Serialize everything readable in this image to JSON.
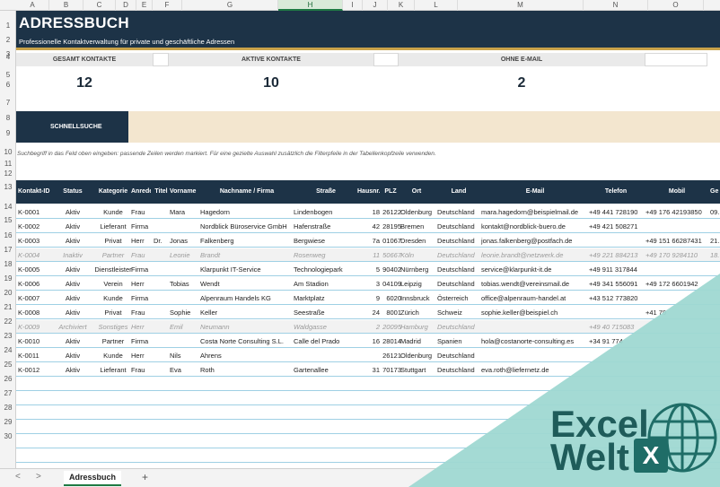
{
  "columns": [
    "A",
    "B",
    "C",
    "D",
    "E",
    "F",
    "G",
    "H",
    "I",
    "J",
    "K",
    "L",
    "M",
    "N",
    "O"
  ],
  "selected_column": "H",
  "rows": [
    "1",
    "2",
    "3",
    "4",
    "5",
    "6",
    "7",
    "8",
    "9",
    "10",
    "11",
    "12",
    "13",
    "14",
    "15",
    "16",
    "17",
    "18",
    "19",
    "20",
    "21",
    "22",
    "23",
    "24",
    "25",
    "26",
    "27",
    "28",
    "29",
    "30"
  ],
  "header": {
    "title": "ADRESSBUCH",
    "subtitle": "Professionelle Kontaktverwaltung für private und geschäftliche Adressen"
  },
  "kpis": [
    {
      "label": "GESAMT KONTAKTE",
      "value": "12"
    },
    {
      "label": "AKTIVE KONTAKTE",
      "value": "10"
    },
    {
      "label": "OHNE E-MAIL",
      "value": "2"
    }
  ],
  "quicksearch": {
    "label": "SCHNELLSUCHE",
    "value": ""
  },
  "hint": "Suchbegriff in das Feld oben eingeben: passende Zeilen werden markiert. Für eine gezielte Auswahl zusätzlich die Filterpfeile in der Tabellenkopfzeile verwenden.",
  "table": {
    "headers": [
      "Kontakt-ID",
      "Status",
      "Kategorie",
      "Anrede",
      "Titel",
      "Vorname",
      "Nachname / Firma",
      "Straße",
      "Hausnr.",
      "PLZ",
      "Ort",
      "Land",
      "E-Mail",
      "Telefon",
      "Mobil",
      "Ge"
    ],
    "rows": [
      {
        "inactive": false,
        "cells": [
          "K-0001",
          "Aktiv",
          "Kunde",
          "Frau",
          "",
          "Mara",
          "Hagedorn",
          "Lindenbogen",
          "18",
          "26122",
          "Oldenburg",
          "Deutschland",
          "mara.hagedorn@beispielmail.de",
          "+49 441 728190",
          "+49 176 42193850",
          "09."
        ]
      },
      {
        "inactive": false,
        "cells": [
          "K-0002",
          "Aktiv",
          "Lieferant",
          "Firma",
          "",
          "",
          "Nordblick Büroservice GmbH",
          "Hafenstraße",
          "42",
          "28195",
          "Bremen",
          "Deutschland",
          "kontakt@nordblick-buero.de",
          "+49 421 508271",
          "",
          ""
        ]
      },
      {
        "inactive": false,
        "cells": [
          "K-0003",
          "Aktiv",
          "Privat",
          "Herr",
          "Dr.",
          "Jonas",
          "Falkenberg",
          "Bergwiese",
          "7a",
          "01067",
          "Dresden",
          "Deutschland",
          "jonas.falkenberg@postfach.de",
          "",
          "+49 151 66287431",
          "21."
        ]
      },
      {
        "inactive": true,
        "cells": [
          "K-0004",
          "Inaktiv",
          "Partner",
          "Frau",
          "",
          "Leonie",
          "Brandt",
          "Rosenweg",
          "11",
          "50667",
          "Köln",
          "Deutschland",
          "leonie.brandt@netzwerk.de",
          "+49 221 884213",
          "+49 170 9284110",
          "18."
        ]
      },
      {
        "inactive": false,
        "cells": [
          "K-0005",
          "Aktiv",
          "Dienstleister",
          "Firma",
          "",
          "",
          "Klarpunkt IT-Service",
          "Technologiepark",
          "5",
          "90402",
          "Nürnberg",
          "Deutschland",
          "service@klarpunkt-it.de",
          "+49 911 317844",
          "",
          ""
        ]
      },
      {
        "inactive": false,
        "cells": [
          "K-0006",
          "Aktiv",
          "Verein",
          "Herr",
          "",
          "Tobias",
          "Wendt",
          "Am Stadion",
          "3",
          "04109",
          "Leipzig",
          "Deutschland",
          "tobias.wendt@vereinsmail.de",
          "+49 341 556091",
          "+49 172 6601942",
          ""
        ]
      },
      {
        "inactive": false,
        "cells": [
          "K-0007",
          "Aktiv",
          "Kunde",
          "Firma",
          "",
          "",
          "Alpenraum Handels KG",
          "Marktplatz",
          "9",
          "6020",
          "Innsbruck",
          "Österreich",
          "office@alpenraum-handel.at",
          "+43 512 773820",
          "",
          ""
        ]
      },
      {
        "inactive": false,
        "cells": [
          "K-0008",
          "Aktiv",
          "Privat",
          "Frau",
          "",
          "Sophie",
          "Keller",
          "Seestraße",
          "24",
          "8001",
          "Zürich",
          "Schweiz",
          "sophie.keller@beispiel.ch",
          "",
          "+41 79",
          ""
        ]
      },
      {
        "inactive": true,
        "cells": [
          "K-0009",
          "Archiviert",
          "Sonstiges",
          "Herr",
          "",
          "Emil",
          "Neumann",
          "Waldgasse",
          "2",
          "20095",
          "Hamburg",
          "Deutschland",
          "",
          "+49 40 715083",
          "",
          ""
        ]
      },
      {
        "inactive": false,
        "cells": [
          "K-0010",
          "Aktiv",
          "Partner",
          "Firma",
          "",
          "",
          "Costa Norte Consulting S.L.",
          "Calle del Prado",
          "16",
          "28014",
          "Madrid",
          "Spanien",
          "hola@costanorte-consulting.es",
          "+34 91 774",
          "",
          ""
        ]
      },
      {
        "inactive": false,
        "cells": [
          "K-0011",
          "Aktiv",
          "Kunde",
          "Herr",
          "",
          "Nils",
          "Ahrens",
          "",
          "",
          "26121",
          "Oldenburg",
          "Deutschland",
          "",
          "",
          "",
          ""
        ]
      },
      {
        "inactive": false,
        "cells": [
          "K-0012",
          "Aktiv",
          "Lieferant",
          "Frau",
          "",
          "Eva",
          "Roth",
          "Gartenallee",
          "31",
          "70173",
          "Stuttgart",
          "Deutschland",
          "eva.roth@liefernetz.de",
          "",
          "",
          ""
        ]
      }
    ]
  },
  "tabs": {
    "active": "Adressbuch",
    "nav_prev": "<",
    "nav_next": ">",
    "add": "+"
  },
  "watermark": {
    "line1": "Excel",
    "line2": "Welt",
    "badge": "X"
  }
}
